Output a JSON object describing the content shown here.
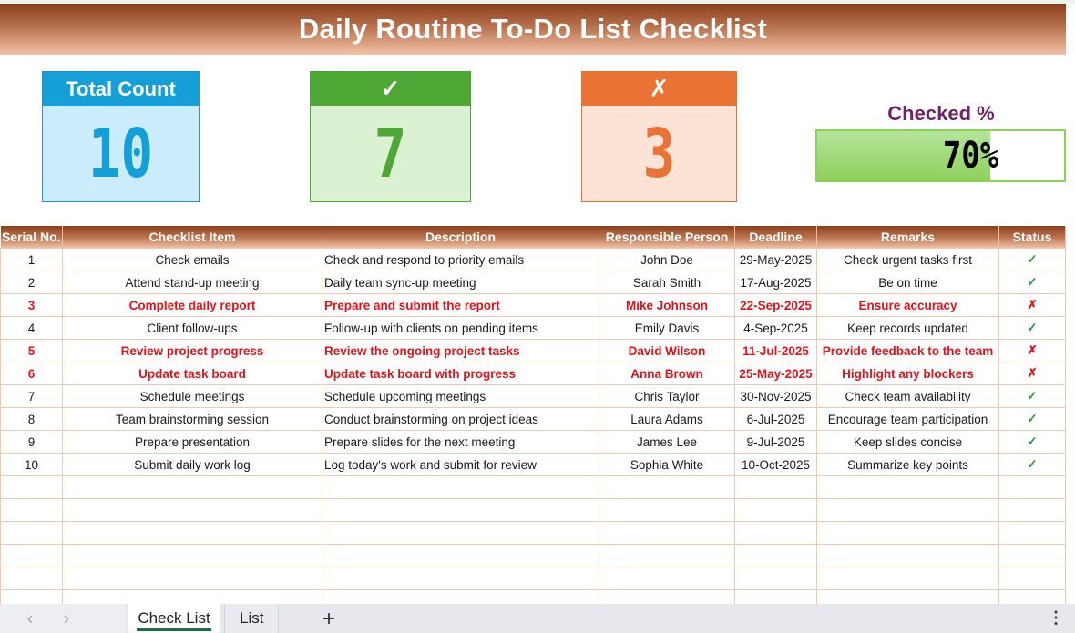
{
  "title": "Daily Routine To-Do List Checklist",
  "kpis": {
    "total": {
      "label": "Total Count",
      "value": "10"
    },
    "checked": {
      "label": "✓",
      "value": "7"
    },
    "unchecked": {
      "label": "✗",
      "value": "3"
    }
  },
  "checked_pct": {
    "label": "Checked %",
    "value_text": "70%",
    "fraction": 0.7
  },
  "colors": {
    "accent_brown": "#8a3f1c",
    "check_green": "#2a9a40",
    "cross_red": "#e0131b",
    "total_blue": "#159fd8",
    "checked_green": "#4fa735",
    "unchecked_orange": "#e97234"
  },
  "table": {
    "headers": [
      "Serial No.",
      "Checklist Item",
      "Description",
      "Responsible Person",
      "Deadline",
      "Remarks",
      "Status"
    ],
    "rows": [
      {
        "serial": "1",
        "item": "Check emails",
        "description": "Check and respond to priority emails",
        "person": "John Doe",
        "deadline": "29-May-2025",
        "remarks": "Check urgent tasks first",
        "status": "✓",
        "done": true
      },
      {
        "serial": "2",
        "item": "Attend stand-up meeting",
        "description": "Daily team sync-up meeting",
        "person": "Sarah Smith",
        "deadline": "17-Aug-2025",
        "remarks": "Be on time",
        "status": "✓",
        "done": true
      },
      {
        "serial": "3",
        "item": "Complete daily report",
        "description": "Prepare and submit the report",
        "person": "Mike Johnson",
        "deadline": "22-Sep-2025",
        "remarks": "Ensure accuracy",
        "status": "✗",
        "done": false
      },
      {
        "serial": "4",
        "item": "Client follow-ups",
        "description": "Follow-up with clients on pending items",
        "person": "Emily Davis",
        "deadline": "4-Sep-2025",
        "remarks": "Keep records updated",
        "status": "✓",
        "done": true
      },
      {
        "serial": "5",
        "item": "Review project progress",
        "description": "Review the ongoing project tasks",
        "person": "David Wilson",
        "deadline": "11-Jul-2025",
        "remarks": "Provide feedback to the team",
        "status": "✗",
        "done": false
      },
      {
        "serial": "6",
        "item": "Update task board",
        "description": "Update task board with progress",
        "person": "Anna Brown",
        "deadline": "25-May-2025",
        "remarks": "Highlight any blockers",
        "status": "✗",
        "done": false
      },
      {
        "serial": "7",
        "item": "Schedule meetings",
        "description": "Schedule upcoming meetings",
        "person": "Chris Taylor",
        "deadline": "30-Nov-2025",
        "remarks": "Check team availability",
        "status": "✓",
        "done": true
      },
      {
        "serial": "8",
        "item": "Team brainstorming session",
        "description": "Conduct brainstorming on project ideas",
        "person": "Laura Adams",
        "deadline": "6-Jul-2025",
        "remarks": "Encourage team participation",
        "status": "✓",
        "done": true
      },
      {
        "serial": "9",
        "item": "Prepare presentation",
        "description": "Prepare slides for the next meeting",
        "person": "James Lee",
        "deadline": "9-Jul-2025",
        "remarks": "Keep slides concise",
        "status": "✓",
        "done": true
      },
      {
        "serial": "10",
        "item": "Submit daily work log",
        "description": "Log today's work and submit for review",
        "person": "Sophia White",
        "deadline": "10-Oct-2025",
        "remarks": "Summarize key points",
        "status": "✓",
        "done": true
      }
    ],
    "empty_rows": 6
  },
  "sheet_tabs": {
    "prev_icon": "chevron-left-icon",
    "next_icon": "chevron-right-icon",
    "tabs": [
      {
        "label": "Check List",
        "active": true
      },
      {
        "label": "List",
        "active": false
      }
    ],
    "add_label": "+",
    "more_label": "⋮"
  }
}
